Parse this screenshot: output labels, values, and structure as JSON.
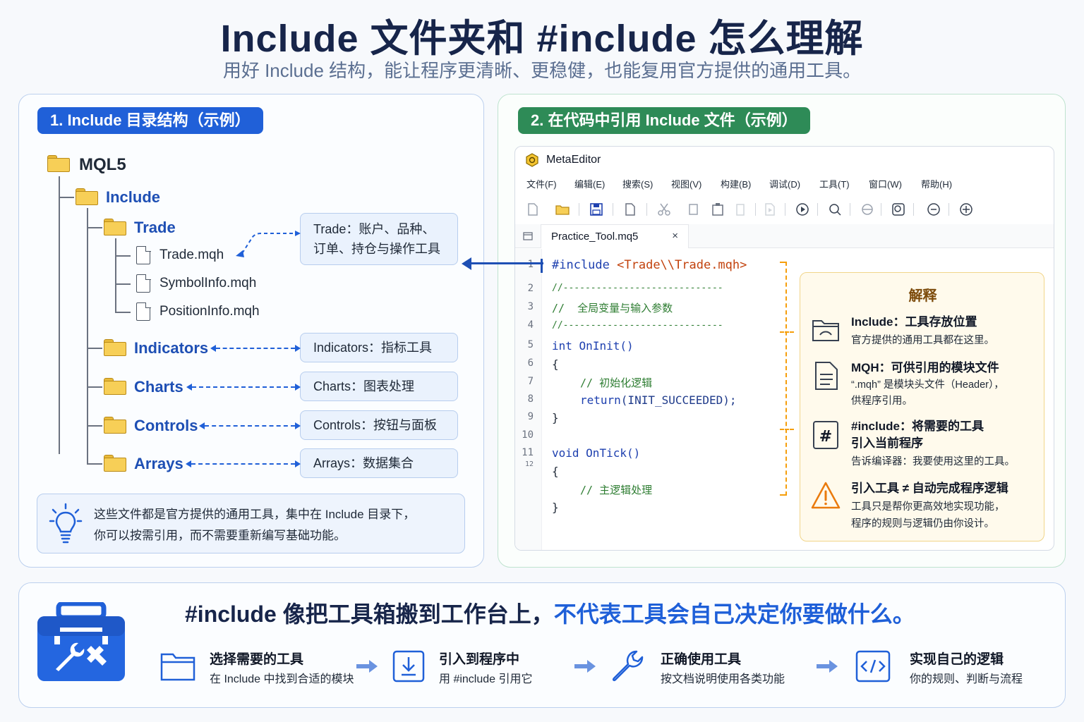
{
  "title": "Include 文件夹和 #include 怎么理解",
  "subtitle": "用好 Include 结构，能让程序更清晰、更稳健，也能复用官方提供的通用工具。",
  "left_panel": {
    "heading": "1. Include 目录结构（示例）",
    "tree": {
      "root": "MQL5",
      "include": "Include",
      "trade": "Trade",
      "files": [
        "Trade.mqh",
        "SymbolInfo.mqh",
        "PositionInfo.mqh"
      ],
      "indicators": "Indicators",
      "charts": "Charts",
      "controls": "Controls",
      "arrays": "Arrays"
    },
    "notes": {
      "trade_line1": "Trade：账户、品种、",
      "trade_line2": "订单、持仓与操作工具",
      "indicators": "Indicators：指标工具",
      "charts": "Charts：图表处理",
      "controls": "Controls：按钮与面板",
      "arrays": "Arrays：数据集合"
    },
    "tip_line1": "这些文件都是官方提供的通用工具，集中在 Include 目录下，",
    "tip_line2": "你可以按需引用，而不需要重新编写基础功能。"
  },
  "right_panel": {
    "heading": "2. 在代码中引用 Include 文件（示例）",
    "editor": {
      "app_name": "MetaEditor",
      "menu": [
        "文件(F)",
        "编辑(E)",
        "搜索(S)",
        "视图(V)",
        "构建(B)",
        "调试(D)",
        "工具(T)",
        "窗口(W)",
        "帮助(H)"
      ],
      "tab": "Practice_Tool.mq5",
      "tab_close": "×",
      "line_numbers": [
        "1",
        "2",
        "3",
        "4",
        "5",
        "6",
        "7",
        "8",
        "9",
        "10",
        "11",
        "12"
      ],
      "code": {
        "l1_kw": "#include",
        "l1_str": "<Trade\\\\Trade.mqh>",
        "l2": "//-----------------------------",
        "l3_prefix": "//  ",
        "l3_text": "全局变量与输入参数",
        "l4": "//-----------------------------",
        "l5_kw": "int",
        "l5_fn": "OnInit()",
        "l6": "{",
        "l7": "// 初始化逻辑",
        "l8_kw": "return",
        "l8_const": "(INIT_SUCCEEDED);",
        "l9": "}",
        "l11_kw": "void",
        "l11_fn": "OnTick()",
        "l12": "{",
        "l13": "// 主逻辑处理",
        "l14": "}"
      }
    },
    "explain": {
      "title": "解释",
      "items": [
        {
          "head": "Include：工具存放位置",
          "sub": [
            "官方提供的通用工具都在这里。"
          ]
        },
        {
          "head": "MQH：可供引用的模块文件",
          "sub": [
            "“.mqh” 是模块头文件（Header），",
            "供程序引用。"
          ]
        },
        {
          "head": "#include：将需要的工具",
          "head2": "引入当前程序",
          "sub": [
            "告诉编译器：我要使用这里的工具。"
          ]
        },
        {
          "head": "引入工具 ≠ 自动完成程序逻辑",
          "sub": [
            "工具只是帮你更高效地实现功能，",
            "程序的规则与逻辑仍由你设计。"
          ]
        }
      ]
    }
  },
  "bottom": {
    "headline": "#include 像把工具箱搬到工作台上，",
    "headline_accent": "不代表工具会自己决定你要做什么。",
    "steps": [
      {
        "title": "选择需要的工具",
        "desc": "在 Include 中找到合适的模块",
        "icon": "folder-icon"
      },
      {
        "title": "引入到程序中",
        "desc": "用 #include 引用它",
        "icon": "download-icon"
      },
      {
        "title": "正确使用工具",
        "desc": "按文档说明使用各类功能",
        "icon": "wrench-icon"
      },
      {
        "title": "实现自己的逻辑",
        "desc": "你的规则、判断与流程",
        "icon": "code-icon"
      }
    ]
  },
  "colors": {
    "primary_blue": "#2060d8",
    "green": "#2e8b57",
    "accent_orange": "#f59e0b",
    "title_navy": "#17254a"
  }
}
